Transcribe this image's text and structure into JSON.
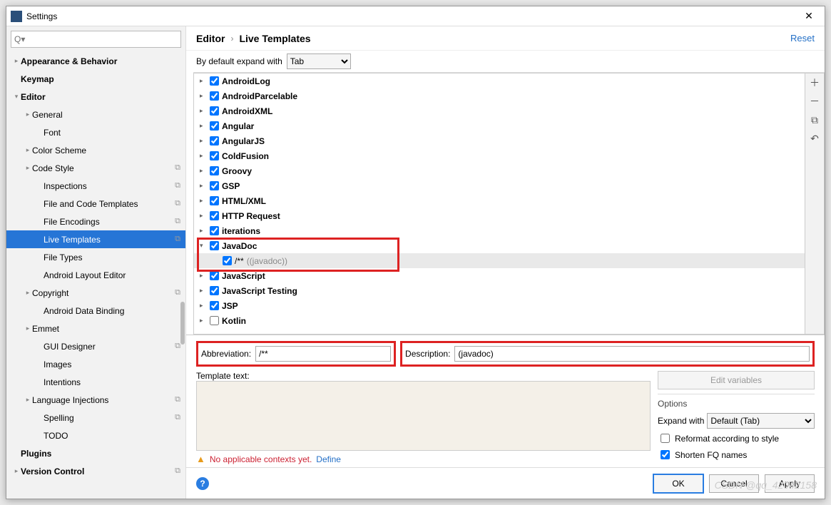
{
  "window": {
    "title": "Settings"
  },
  "search": {
    "placeholder": ""
  },
  "sidebar": [
    {
      "label": "Appearance & Behavior",
      "ind": 0,
      "arrow": "▸",
      "bold": true,
      "mod": false
    },
    {
      "label": "Keymap",
      "ind": 0,
      "arrow": "",
      "bold": true,
      "mod": false
    },
    {
      "label": "Editor",
      "ind": 0,
      "arrow": "▾",
      "bold": true,
      "mod": false
    },
    {
      "label": "General",
      "ind": 1,
      "arrow": "▸",
      "bold": false,
      "mod": false
    },
    {
      "label": "Font",
      "ind": 2,
      "arrow": "",
      "bold": false,
      "mod": false
    },
    {
      "label": "Color Scheme",
      "ind": 1,
      "arrow": "▸",
      "bold": false,
      "mod": false
    },
    {
      "label": "Code Style",
      "ind": 1,
      "arrow": "▸",
      "bold": false,
      "mod": true
    },
    {
      "label": "Inspections",
      "ind": 2,
      "arrow": "",
      "bold": false,
      "mod": true
    },
    {
      "label": "File and Code Templates",
      "ind": 2,
      "arrow": "",
      "bold": false,
      "mod": true
    },
    {
      "label": "File Encodings",
      "ind": 2,
      "arrow": "",
      "bold": false,
      "mod": true
    },
    {
      "label": "Live Templates",
      "ind": 2,
      "arrow": "",
      "bold": false,
      "mod": true,
      "selected": true
    },
    {
      "label": "File Types",
      "ind": 2,
      "arrow": "",
      "bold": false,
      "mod": false
    },
    {
      "label": "Android Layout Editor",
      "ind": 2,
      "arrow": "",
      "bold": false,
      "mod": false
    },
    {
      "label": "Copyright",
      "ind": 1,
      "arrow": "▸",
      "bold": false,
      "mod": true
    },
    {
      "label": "Android Data Binding",
      "ind": 2,
      "arrow": "",
      "bold": false,
      "mod": false
    },
    {
      "label": "Emmet",
      "ind": 1,
      "arrow": "▸",
      "bold": false,
      "mod": false
    },
    {
      "label": "GUI Designer",
      "ind": 2,
      "arrow": "",
      "bold": false,
      "mod": true
    },
    {
      "label": "Images",
      "ind": 2,
      "arrow": "",
      "bold": false,
      "mod": false
    },
    {
      "label": "Intentions",
      "ind": 2,
      "arrow": "",
      "bold": false,
      "mod": false
    },
    {
      "label": "Language Injections",
      "ind": 1,
      "arrow": "▸",
      "bold": false,
      "mod": true
    },
    {
      "label": "Spelling",
      "ind": 2,
      "arrow": "",
      "bold": false,
      "mod": true
    },
    {
      "label": "TODO",
      "ind": 2,
      "arrow": "",
      "bold": false,
      "mod": false
    },
    {
      "label": "Plugins",
      "ind": 0,
      "arrow": "",
      "bold": true,
      "mod": false
    },
    {
      "label": "Version Control",
      "ind": 0,
      "arrow": "▸",
      "bold": true,
      "mod": true
    }
  ],
  "breadcrumb": {
    "a": "Editor",
    "b": "Live Templates",
    "reset": "Reset"
  },
  "expand": {
    "label": "By default expand with",
    "value": "Tab"
  },
  "templates": [
    {
      "label": "AndroidLog",
      "arrow": "▸",
      "checked": true
    },
    {
      "label": "AndroidParcelable",
      "arrow": "▸",
      "checked": true
    },
    {
      "label": "AndroidXML",
      "arrow": "▸",
      "checked": true
    },
    {
      "label": "Angular",
      "arrow": "▸",
      "checked": true
    },
    {
      "label": "AngularJS",
      "arrow": "▸",
      "checked": true
    },
    {
      "label": "ColdFusion",
      "arrow": "▸",
      "checked": true
    },
    {
      "label": "Groovy",
      "arrow": "▸",
      "checked": true
    },
    {
      "label": "GSP",
      "arrow": "▸",
      "checked": true
    },
    {
      "label": "HTML/XML",
      "arrow": "▸",
      "checked": true
    },
    {
      "label": "HTTP Request",
      "arrow": "▸",
      "checked": true
    },
    {
      "label": "iterations",
      "arrow": "▸",
      "checked": true
    },
    {
      "label": "JavaDoc",
      "arrow": "▾",
      "checked": true,
      "open": true,
      "child": {
        "label": "/**",
        "desc": "((javadoc))",
        "checked": true
      }
    },
    {
      "label": "JavaScript",
      "arrow": "▸",
      "checked": true
    },
    {
      "label": "JavaScript Testing",
      "arrow": "▸",
      "checked": true
    },
    {
      "label": "JSP",
      "arrow": "▸",
      "checked": true
    },
    {
      "label": "Kotlin",
      "arrow": "▸",
      "checked": false
    }
  ],
  "detail": {
    "abbr_label": "Abbreviation:",
    "abbr_value": "/**",
    "desc_label": "Description:",
    "desc_value": "(javadoc)",
    "templ_label": "Template text:",
    "editvars": "Edit variables",
    "options_title": "Options",
    "expandwith_label": "Expand with",
    "expandwith_value": "Default (Tab)",
    "reformat_label": "Reformat according to style",
    "reformat_checked": false,
    "shorten_label": "Shorten FQ names",
    "shorten_checked": true,
    "context_warn": "No applicable contexts yet.",
    "define": "Define"
  },
  "footer": {
    "ok": "OK",
    "cancel": "Cancel",
    "apply": "Apply"
  },
  "watermark": "CSDN @qq_42042158"
}
